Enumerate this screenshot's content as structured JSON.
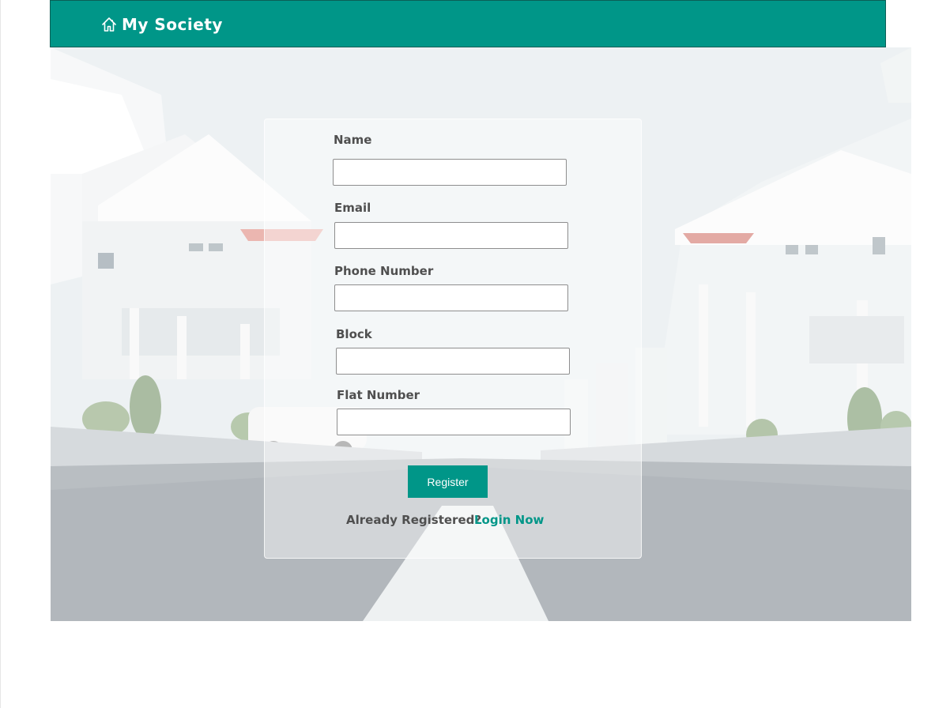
{
  "header": {
    "brand_icon": "home-icon",
    "brand_title": "My Society"
  },
  "form": {
    "fields": [
      {
        "label": "Name",
        "value": ""
      },
      {
        "label": "Email",
        "value": ""
      },
      {
        "label": "Phone Number",
        "value": ""
      },
      {
        "label": "Block",
        "value": ""
      },
      {
        "label": "Flat Number",
        "value": ""
      }
    ],
    "register_label": "Register",
    "already_text": "Already Registered?",
    "login_link": "Login Now"
  },
  "colors": {
    "accent": "#009688",
    "label_text": "#4f4f4f"
  }
}
